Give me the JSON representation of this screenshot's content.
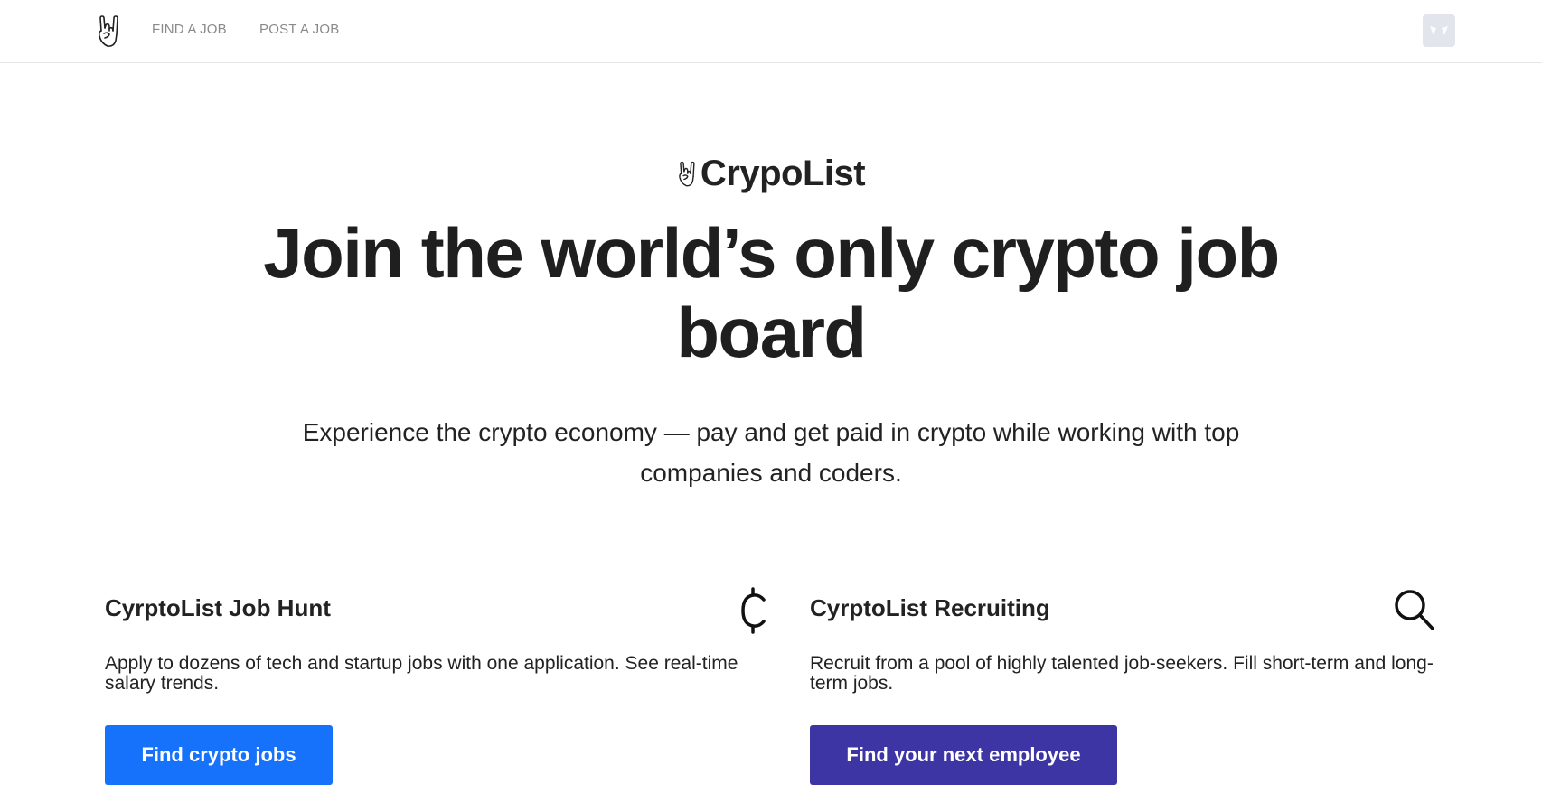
{
  "nav": {
    "logo_icon": "rock-hand-icon",
    "find_job": "FIND A JOB",
    "post_job": "POST A JOB",
    "avatar_icon": "user-avatar-icon"
  },
  "hero": {
    "brand_icon": "rock-hand-icon",
    "brand_name": "CrypoList",
    "headline": "Join the world’s only crypto job board",
    "subtitle": "Experience the crypto economy — pay and get paid in crypto while working with top companies and coders."
  },
  "cards": [
    {
      "title": "CyrptoList Job Hunt",
      "icon": "cent-currency-icon",
      "description": "Apply to dozens of tech and startup jobs with one application. See real-time salary trends.",
      "button": "Find crypto jobs",
      "button_color": "#1672fb"
    },
    {
      "title": "CyrptoList Recruiting",
      "icon": "search-icon",
      "description": "Recruit from a pool of highly talented job-seekers. Fill short-term and long-term jobs.",
      "button": "Find your next employee",
      "button_color": "#3e35a5"
    }
  ]
}
